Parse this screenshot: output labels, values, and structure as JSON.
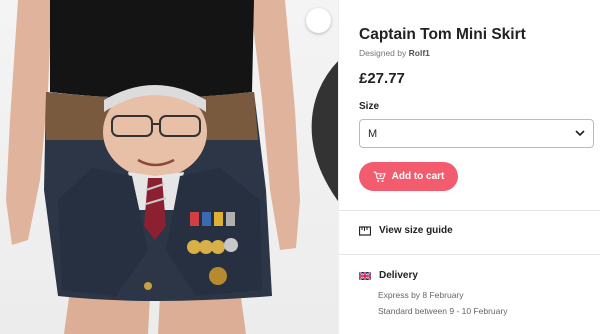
{
  "product": {
    "title": "Captain Tom Mini Skirt",
    "designer_prefix": "Designed by ",
    "designer_name": "Rolf1",
    "price": "£27.77"
  },
  "size": {
    "label": "Size",
    "selected": "M"
  },
  "actions": {
    "add_to_cart": "Add to cart",
    "view_size_guide": "View size guide"
  },
  "delivery": {
    "heading": "Delivery",
    "express": "Express by 8 February",
    "standard": "Standard between 9 - 10 February"
  },
  "colors": {
    "accent": "#f25c6e",
    "text": "#222222",
    "muted": "#777777"
  },
  "icons": {
    "wishlist": "heart-icon",
    "dropdown": "chevron-down-icon",
    "cart": "cart-icon",
    "size_guide": "ruler-icon",
    "delivery": "uk-flag-icon"
  }
}
